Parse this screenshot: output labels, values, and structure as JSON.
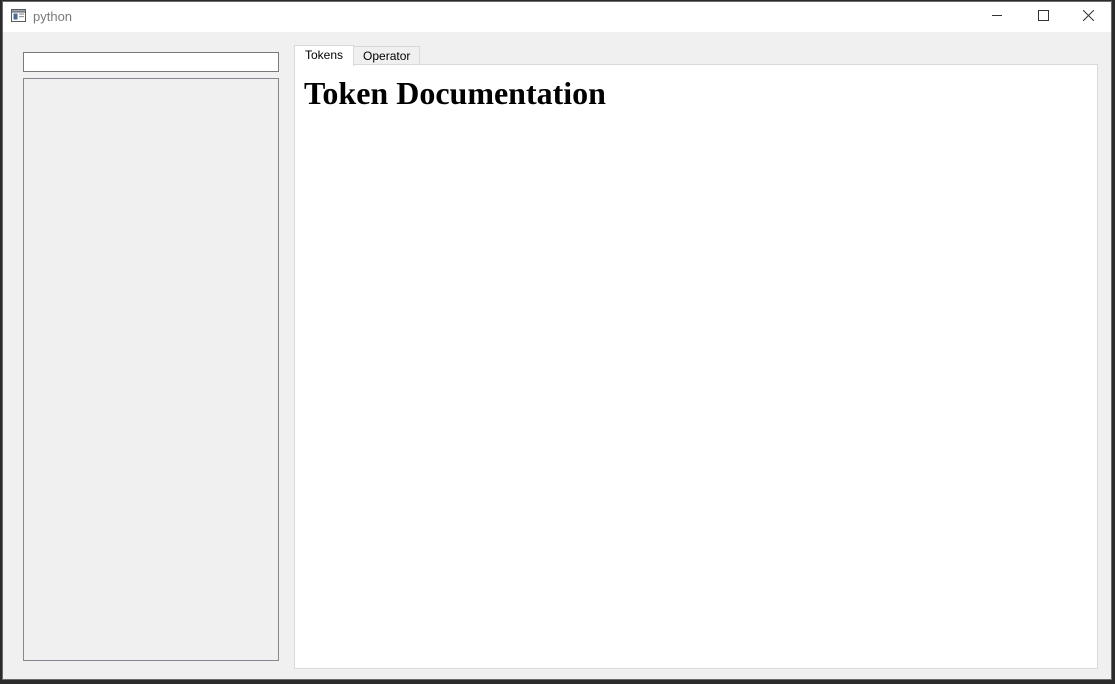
{
  "window": {
    "title": "python"
  },
  "titlebar": {
    "icons": {
      "app": "app-window-icon",
      "minimize": "minimize-icon",
      "maximize": "maximize-icon",
      "close": "close-icon"
    }
  },
  "sidebar": {
    "search": {
      "value": "",
      "placeholder": ""
    },
    "list": {
      "items": []
    }
  },
  "tabs": [
    {
      "label": "Tokens",
      "active": true
    },
    {
      "label": "Operator",
      "active": false
    }
  ],
  "content": {
    "heading": "Token Documentation"
  },
  "colors": {
    "window_bg": "#f0f0f0",
    "titlebar_bg": "#ffffff",
    "title_text": "#7a7a7a",
    "content_bg": "#ffffff"
  }
}
